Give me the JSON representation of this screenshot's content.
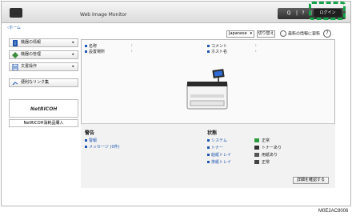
{
  "header": {
    "app_title": "Web Image Monitor",
    "tools": [
      "Q",
      "|",
      "?",
      "|",
      "i"
    ],
    "login_label": "ログイン"
  },
  "breadcrumb": "‹ホーム",
  "toolbar": {
    "language": "Japanese",
    "switch_label": "切り替え",
    "refresh_label": "最新の情報に更新",
    "help_symbol": "?"
  },
  "sidebar": {
    "items": [
      {
        "label": "機器の情報",
        "icon": "info-icon"
      },
      {
        "label": "機器の管理",
        "icon": "device-manage-icon"
      },
      {
        "label": "文書操作",
        "icon": "document-icon"
      }
    ],
    "link_label": "便利なリンク集",
    "ricoh_label": "NetRICOH",
    "ricoh_button": "NetRICOH消耗品購入"
  },
  "device_info": {
    "name_label": "名称",
    "location_label": "設置場所",
    "comment_label": "コメント",
    "host_label": "ホスト名",
    "colon": ":"
  },
  "alerts": {
    "title": "警告",
    "items": [
      "警報",
      "メッセージ (0件)"
    ]
  },
  "status": {
    "title": "状態",
    "items": [
      {
        "label": "システム",
        "value": "正常"
      },
      {
        "label": "トナー",
        "value": "トナーあり"
      },
      {
        "label": "給紙トレイ",
        "value": "用紙あり"
      },
      {
        "label": "排紙トレイ",
        "value": "正常"
      }
    ],
    "confirm_button": "詳細を確認する"
  },
  "figure_code": "M0E2AC8006",
  "colors": {
    "accent_blue": "#1f57b1",
    "login_highlight": "#15a34a"
  }
}
